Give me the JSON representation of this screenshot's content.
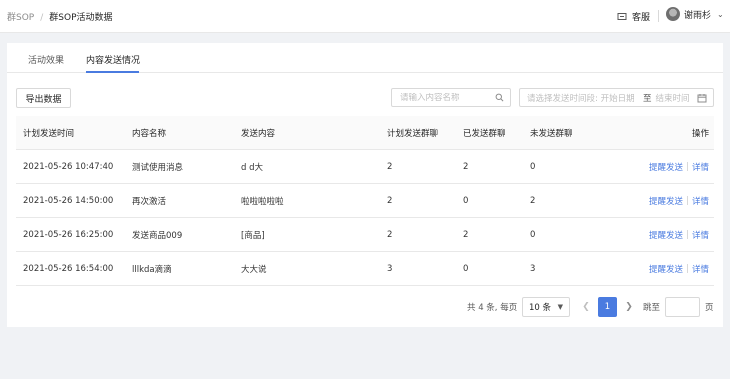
{
  "breadcrumb": {
    "root": "群SOP",
    "separator": "/",
    "current": "群SOP活动数据"
  },
  "header": {
    "service_label": "客服",
    "user_name": "谢雨杉"
  },
  "tabs": [
    {
      "label": "活动效果",
      "active": false
    },
    {
      "label": "内容发送情况",
      "active": true
    }
  ],
  "toolbar": {
    "export_label": "导出数据",
    "search_placeholder": "请输入内容名称",
    "date_range": {
      "prefix": "请选择发送时间段:",
      "start_placeholder": "开始日期",
      "separator": "至",
      "end_placeholder": "结束时间"
    }
  },
  "table": {
    "columns": [
      "计划发送时间",
      "内容名称",
      "发送内容",
      "计划发送群聊",
      "已发送群聊",
      "未发送群聊",
      "操作"
    ],
    "rows": [
      {
        "time": "2021-05-26 10:47:40",
        "name": "测试使用消息",
        "content": "d d大",
        "planned": "2",
        "sent": "2",
        "unsent": "0"
      },
      {
        "time": "2021-05-26 14:50:00",
        "name": "再次激活",
        "content": "啦啦啦啦啦",
        "planned": "2",
        "sent": "0",
        "unsent": "2"
      },
      {
        "time": "2021-05-26 16:25:00",
        "name": "发送商品009",
        "content": "[商品]",
        "planned": "2",
        "sent": "2",
        "unsent": "0"
      },
      {
        "time": "2021-05-26 16:54:00",
        "name": "lllkda滴滴",
        "content": "大大说",
        "planned": "3",
        "sent": "0",
        "unsent": "3"
      }
    ],
    "actions": {
      "remind": "提醒发送",
      "detail": "详情"
    }
  },
  "pagination": {
    "total_text": "共 4 条, 每页",
    "page_size": "10 条",
    "current_page": "1",
    "jump_label": "跳至",
    "page_suffix": "页"
  },
  "colors": {
    "accent": "#4a7be0",
    "background": "#f0f2f5"
  }
}
